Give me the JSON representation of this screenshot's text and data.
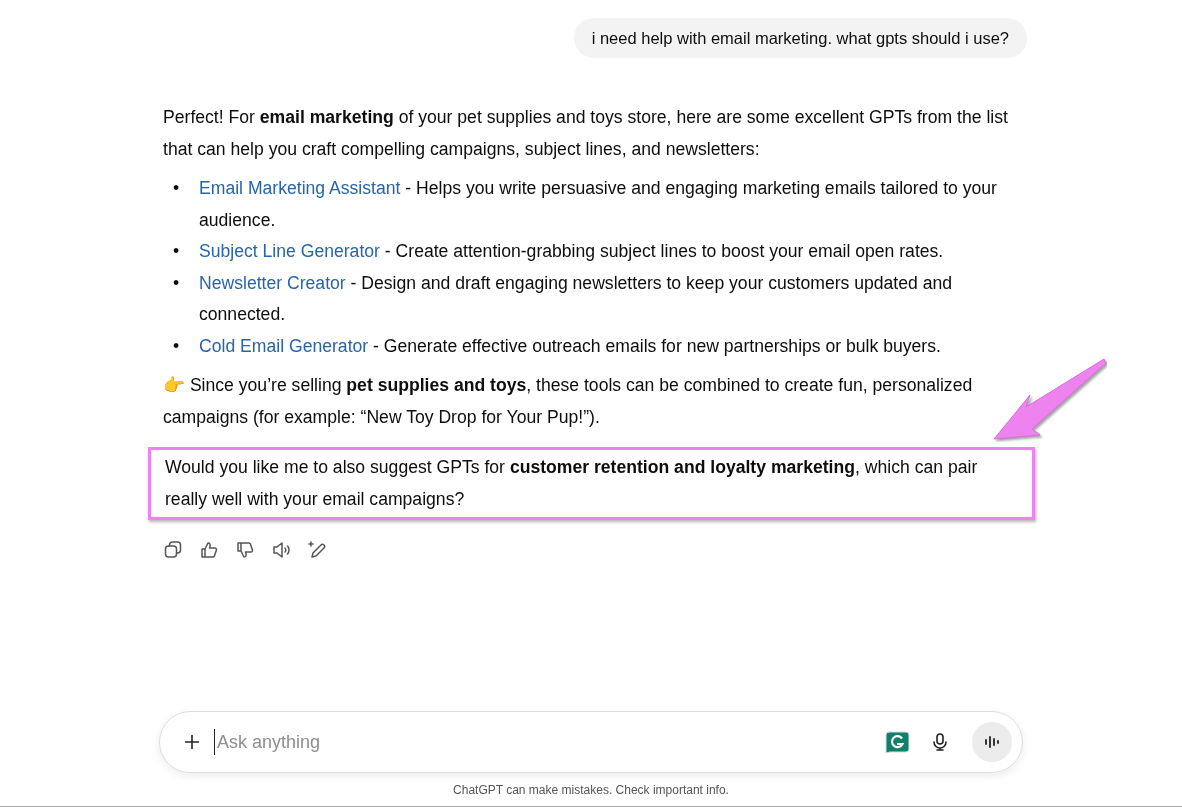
{
  "user_message": "i need help with email marketing. what gpts should i use?",
  "response": {
    "intro": "Perfect! For **email marketing** of your pet supplies and toys store, here are some excellent GPTs from the list that can help you craft compelling campaigns, subject lines, and newsletters:",
    "items": [
      {
        "marker": "•",
        "link": "Email Marketing Assistant",
        "text": " - Helps you write persuasive and engaging marketing emails tailored to your audience."
      },
      {
        "marker": "•",
        "link": "Subject Line Generator",
        "text": " - Create attention-grabbing subject lines to boost your email open rates."
      },
      {
        "marker": "•",
        "link": "Newsletter Creator",
        "text": " - Design and draft engaging newsletters to keep your customers updated and connected."
      },
      {
        "marker": "•",
        "link": "Cold Email Generator",
        "text": " - Generate effective outreach emails for new partnerships or bulk buyers."
      }
    ],
    "note": "👉 Since you’re selling **pet supplies and toys**, these tools can be combined to create fun, personalized campaigns (for example: “New Toy Drop for Your Pup!”).",
    "question": "Would you like me to also suggest GPTs for **customer retention and loyalty marketing**, which can pair really well with your email campaigns?",
    "question_highlighted": true
  },
  "actions": [
    {
      "kind": "copy"
    },
    {
      "kind": "like"
    },
    {
      "kind": "dislike"
    },
    {
      "kind": "read-aloud"
    },
    {
      "kind": "edit"
    }
  ],
  "composer": {
    "placeholder": "Ask anything"
  },
  "footer": "ChatGPT can make mistakes. Check important info."
}
